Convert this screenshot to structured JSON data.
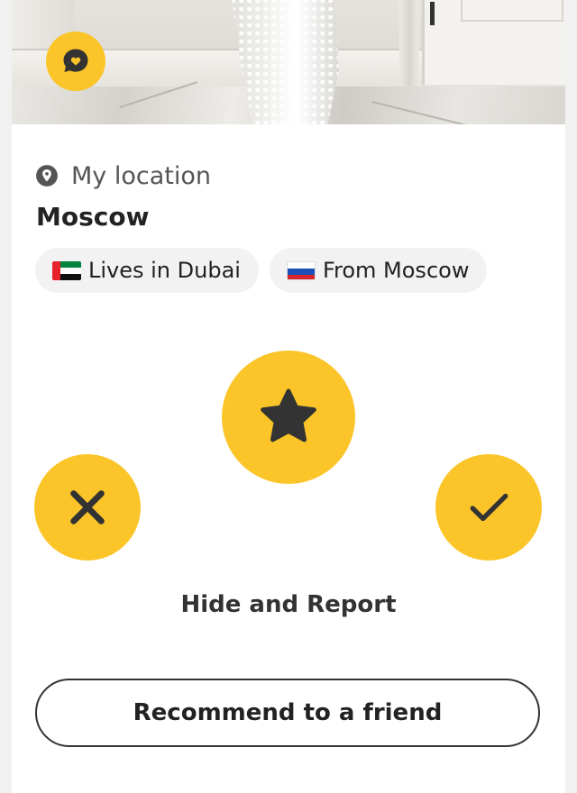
{
  "location": {
    "label": "My location",
    "city": "Moscow",
    "icon": "location-pin-icon"
  },
  "chips": [
    {
      "flag": "uae-flag",
      "text": "Lives in Dubai"
    },
    {
      "flag": "russia-flag",
      "text": "From Moscow"
    }
  ],
  "actions": {
    "superswipe_icon": "star-icon",
    "pass_icon": "close-icon",
    "like_icon": "checkmark-icon",
    "hide_report": "Hide and Report",
    "recommend": "Recommend to a friend"
  },
  "colors": {
    "accent": "#fbc52a",
    "icon_dark": "#333333",
    "chip_bg": "#f2f2f2"
  }
}
